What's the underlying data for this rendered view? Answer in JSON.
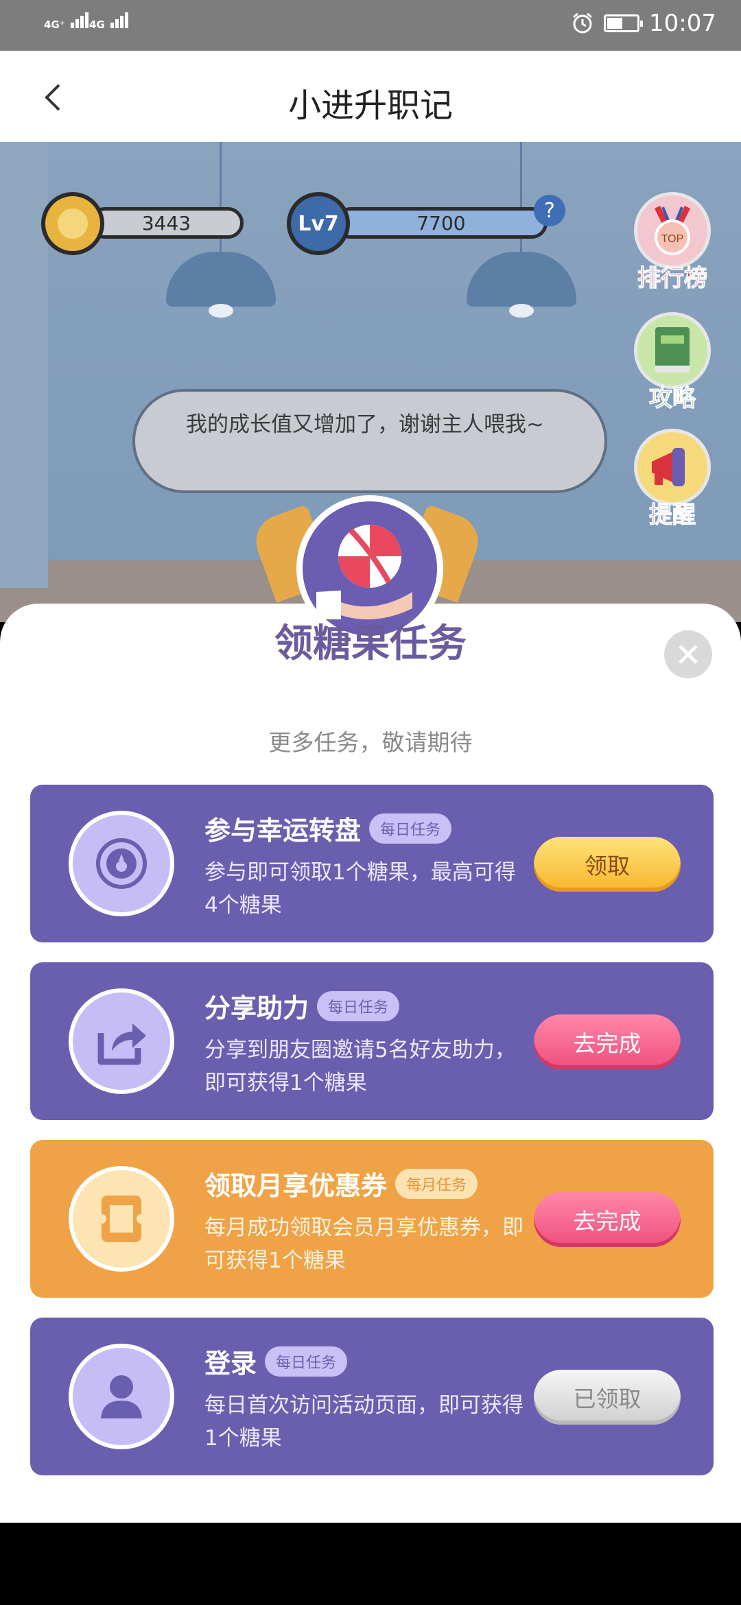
{
  "status_bar": {
    "sim1": "4G⁺",
    "sim2": "4G",
    "time": "10:07",
    "icons": [
      "alarm-icon",
      "battery-icon"
    ]
  },
  "header": {
    "title": "小进升职记",
    "back_icon": "chevron-left-icon"
  },
  "scene": {
    "coins": "3443",
    "level": "Lv7",
    "growth": "7700",
    "help": "?",
    "side_buttons": [
      {
        "label": "排行榜",
        "badge": "TOP",
        "icon": "medal-icon"
      },
      {
        "label": "攻略",
        "icon": "book-icon"
      },
      {
        "label": "提醒",
        "icon": "megaphone-icon"
      }
    ],
    "speech": "我的成长值又增加了，谢谢主人喂我~"
  },
  "modal": {
    "title": "领糖果任务",
    "subtitle": "更多任务，敬请期待",
    "tasks": [
      {
        "name": "参与幸运转盘",
        "tag": "每日任务",
        "desc": "参与即可领取1个糖果，最高可得4个糖果",
        "button": "领取",
        "icon": "wheel-icon",
        "style": "gold"
      },
      {
        "name": "分享助力",
        "tag": "每日任务",
        "desc": "分享到朋友圈邀请5名好友助力，即可获得1个糖果",
        "button": "去完成",
        "icon": "share-icon",
        "style": "pink"
      },
      {
        "name": "领取月享优惠券",
        "tag": "每月任务",
        "desc": "每月成功领取会员月享优惠券，即可获得1个糖果",
        "button": "去完成",
        "icon": "coupon-icon",
        "style": "pink"
      },
      {
        "name": "登录",
        "tag": "每日任务",
        "desc": "每日首次访问活动页面，即可获得1个糖果",
        "button": "已领取",
        "icon": "user-icon",
        "style": "gray"
      }
    ]
  },
  "colors": {
    "purple": "#6a5fae",
    "orange": "#efa346",
    "pink_button": "#ef4f7e",
    "gold_button": "#f7b72c"
  }
}
